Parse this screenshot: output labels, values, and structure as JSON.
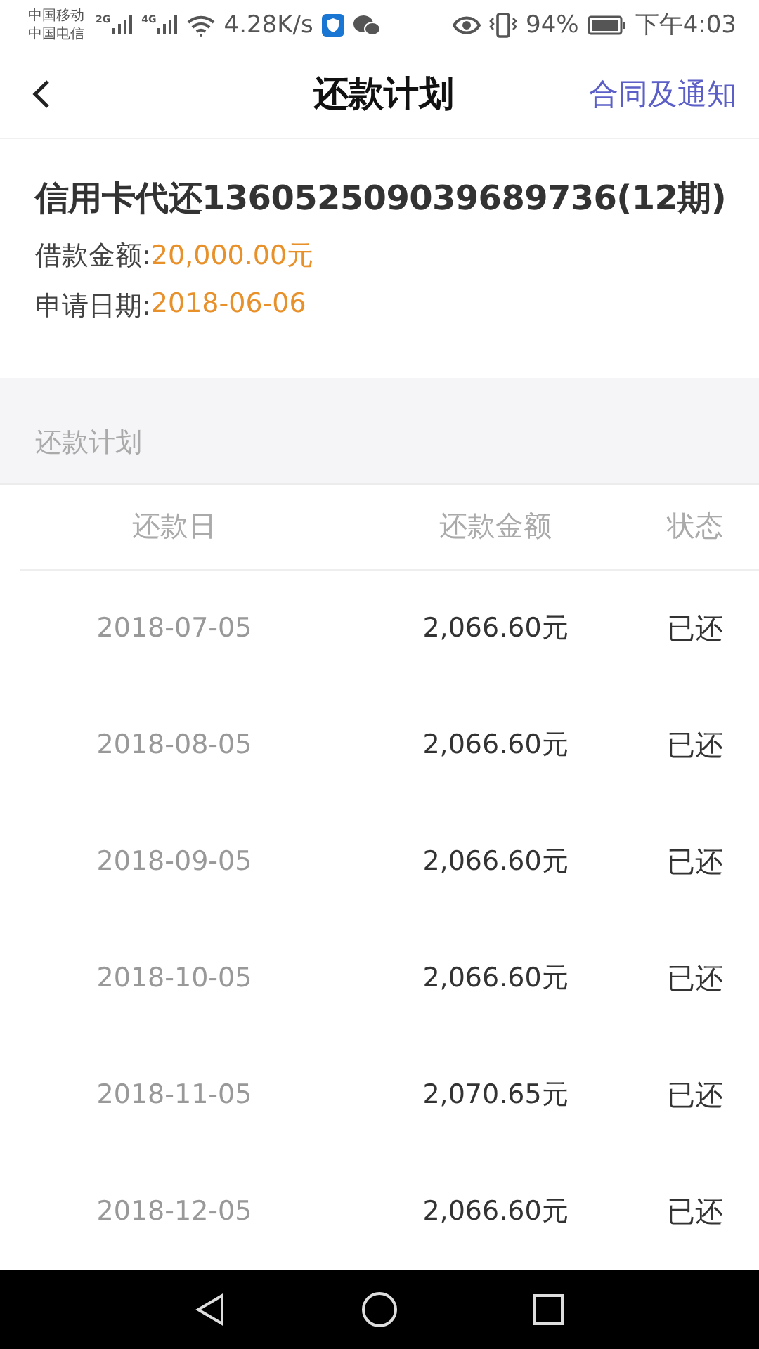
{
  "status_bar": {
    "carriers": [
      "中国移动",
      "中国电信"
    ],
    "network_types": [
      "2G",
      "4G"
    ],
    "speed": "4.28K/s",
    "battery_percent": "94%",
    "time": "下午4:03"
  },
  "header": {
    "title": "还款计划",
    "link": "合同及通知"
  },
  "loan": {
    "title": "信用卡代还136052509039689736(12期)",
    "fields": [
      {
        "label": "借款金额: ",
        "value": "20,000.00元"
      },
      {
        "label": "申请日期: ",
        "value": "2018-06-06"
      }
    ]
  },
  "plan": {
    "section_title": "还款计划",
    "columns": [
      "还款日",
      "还款金额",
      "状态"
    ],
    "rows": [
      {
        "date": "2018-07-05",
        "amount": "2,066.60元",
        "status": "已还"
      },
      {
        "date": "2018-08-05",
        "amount": "2,066.60元",
        "status": "已还"
      },
      {
        "date": "2018-09-05",
        "amount": "2,066.60元",
        "status": "已还"
      },
      {
        "date": "2018-10-05",
        "amount": "2,066.60元",
        "status": "已还"
      },
      {
        "date": "2018-11-05",
        "amount": "2,070.65元",
        "status": "已还"
      },
      {
        "date": "2018-12-05",
        "amount": "2,066.60元",
        "status": "已还"
      }
    ]
  }
}
